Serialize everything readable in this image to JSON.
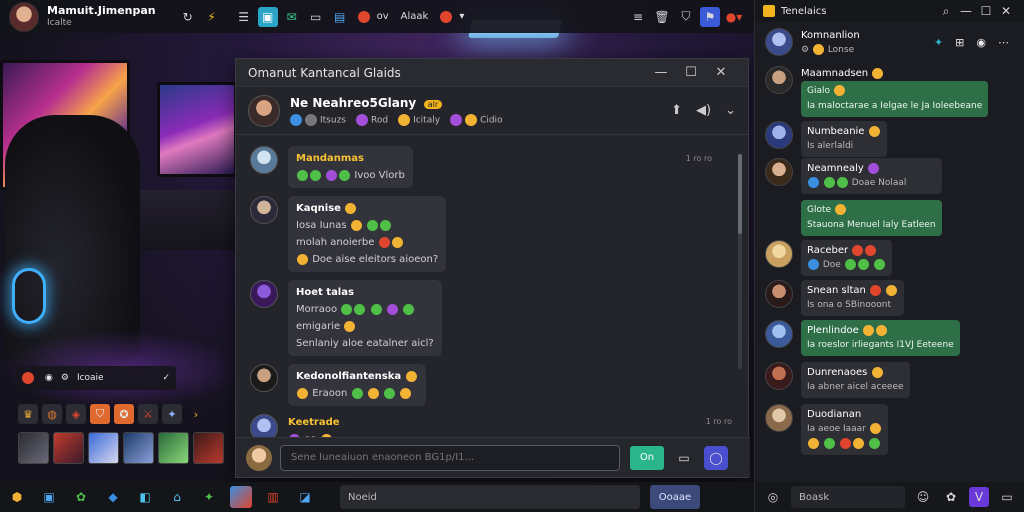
{
  "topbar": {
    "user_name": "Mamuit.Jimenpan",
    "user_status": "Icalte",
    "pill_1": "ov",
    "pill_2": "Alaak"
  },
  "left": {
    "mini_label": "Icoaie"
  },
  "chat": {
    "window_title": "Omanut Kantancal Glaids",
    "contact_name": "Ne Neahreo5Glany",
    "contact_badge": "alr",
    "meta": [
      "Itsuzs",
      "Rod",
      "Icitaly",
      "Cidio"
    ],
    "messages": [
      {
        "name": "Mandanmas",
        "lines": [
          "Ivoo Vlorb"
        ],
        "time": "1 ro ro"
      },
      {
        "name": "Kaqnise",
        "lines": [
          "Iosa Iunas",
          "molah anoierbe",
          "Doe aise eleitors aioeon?"
        ]
      },
      {
        "name": "Hoet talas",
        "lines": [
          "Morraoo",
          "emigarie",
          "Senlaniy aloe eatalner aicl?"
        ]
      },
      {
        "name": "Kedonolfiantenska",
        "lines": [
          "Eraoon"
        ]
      },
      {
        "name": "Keetrade",
        "lines": [
          "oo"
        ],
        "time": "1 ro ro"
      }
    ],
    "composer_placeholder": "Sene Iuneaiuon enaoneon BG1p/I1...",
    "send_label": "On"
  },
  "side": {
    "title": "Tenelaics",
    "items": [
      {
        "name": "Komnanlion",
        "sub": "Lonse"
      },
      {
        "name": "Maamnadsen",
        "sub": "Gialo",
        "green": "Ia maloctarae a Ielgae le Ja Ioleebeane"
      },
      {
        "name": "Numbeanie",
        "sub": "Is alerlaldi"
      },
      {
        "name": "Neamnealy",
        "sub": "Doae Nolaal",
        "green": "Glote",
        "green2": "Stauona Menuel Ialy Eatleen"
      },
      {
        "name": "Raceber",
        "sub": "Doe"
      },
      {
        "name": "Snean sltan",
        "sub": "Is ona o SBinooont"
      },
      {
        "name": "Plenlindoe",
        "green": "Ia roeslor irliegants I1VJ Eeteene"
      },
      {
        "name": "Dunrenaoes",
        "sub": "Ia abner aicel aceeee"
      },
      {
        "name": "Duodianan",
        "sub": "Ia aeoe Iaaar"
      }
    ],
    "bottom_placeholder": "Boask"
  },
  "taskbar": {
    "search_value": "Noeid",
    "button_label": "Ooaae"
  }
}
